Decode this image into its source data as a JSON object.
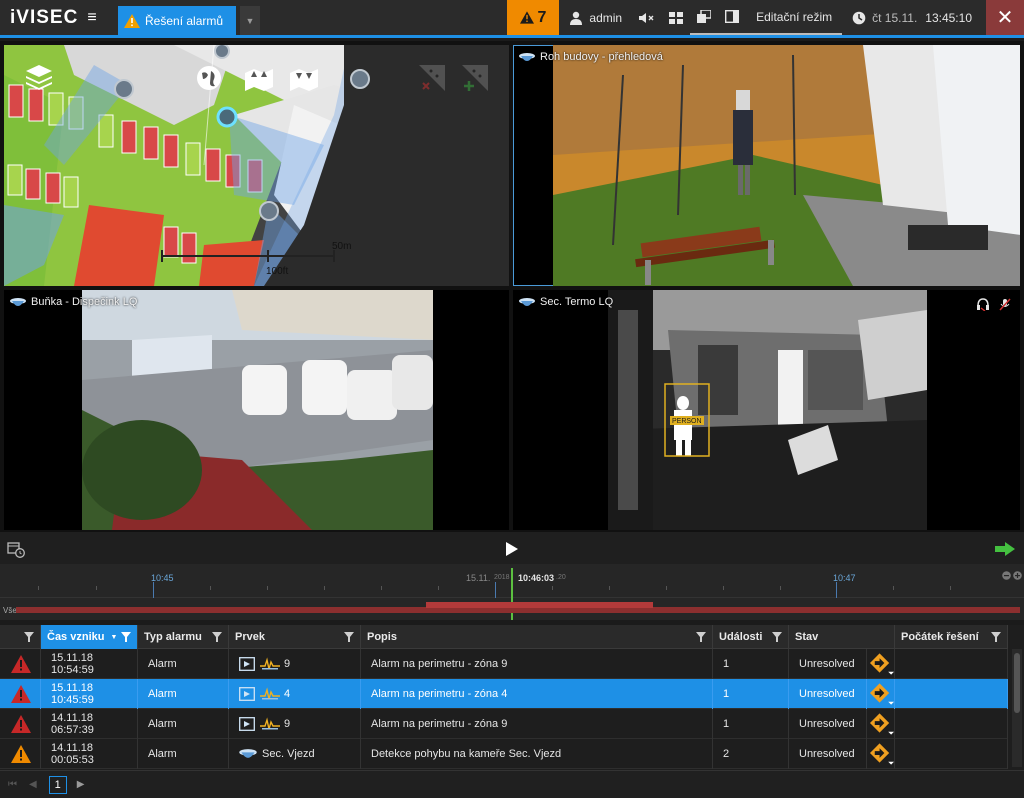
{
  "app": {
    "logo": "iVISEC",
    "active_tab": "Řešení alarmů",
    "alarm_count": "7",
    "user": "admin",
    "mode": "Editační režim",
    "day": "čt 15.11.",
    "time": "13:45:10"
  },
  "map": {
    "scale_m": "50m",
    "scale_ft": "100ft"
  },
  "cameras": [
    {
      "label": "Roh budovy - přehledová"
    },
    {
      "label": "Buňka - Dispečink LQ"
    },
    {
      "label": "Sec. Termo LQ"
    }
  ],
  "thermal": {
    "detection_label": "PERSON"
  },
  "timeline": {
    "tick1": "10:45",
    "tick2": "10:47",
    "date": "15.11.",
    "year": "2018",
    "current": "10:46:03",
    "sub": ".20",
    "left_label": "Vše"
  },
  "table": {
    "headers": [
      "Čas vzniku",
      "Typ alarmu",
      "Prvek",
      "Popis",
      "Události",
      "Stav",
      "Počátek řešení"
    ],
    "rows": [
      {
        "time": "15.11.18 10:54:59",
        "type": "Alarm",
        "element": "9",
        "desc": "Alarm na perimetru - zóna 9",
        "events": "1",
        "state": "Unresolved",
        "severity": "red",
        "icon": "sensor"
      },
      {
        "time": "15.11.18 10:45:59",
        "type": "Alarm",
        "element": "4",
        "desc": "Alarm na perimetru - zóna 4",
        "events": "1",
        "state": "Unresolved",
        "severity": "red",
        "icon": "sensor"
      },
      {
        "time": "14.11.18 06:57:39",
        "type": "Alarm",
        "element": "9",
        "desc": "Alarm na perimetru - zóna 9",
        "events": "1",
        "state": "Unresolved",
        "severity": "red",
        "icon": "sensor"
      },
      {
        "time": "14.11.18 00:05:53",
        "type": "Alarm",
        "element": "Sec. Vjezd",
        "desc": "Detekce pohybu na kameře Sec. Vjezd",
        "events": "2",
        "state": "Unresolved",
        "severity": "orange",
        "icon": "camera"
      }
    ],
    "selected_row": 1
  },
  "pager": {
    "page": "1"
  },
  "colors": {
    "accent": "#1e90e6",
    "alarm": "#f08a00",
    "danger": "#c62828"
  }
}
